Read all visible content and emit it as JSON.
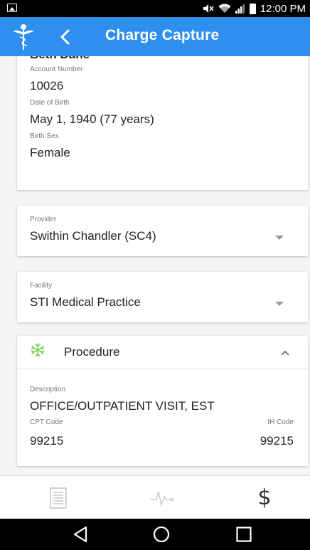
{
  "status_bar": {
    "time": "12:00 PM",
    "icons": [
      "image-notification-icon",
      "mute-icon",
      "wifi-icon",
      "signal-icon",
      "battery-icon"
    ]
  },
  "app_bar": {
    "title": "Charge Capture",
    "logo_icon": "caduceus-icon",
    "back_icon": "chevron-left-icon",
    "color": "#2f8fef"
  },
  "patient": {
    "name": "Beth Dane",
    "account_number_label": "Account Number",
    "account_number": "10026",
    "dob_label": "Date of Birth",
    "dob": "May 1, 1940 (77 years)",
    "birth_sex_label": "Birth Sex",
    "birth_sex": "Female"
  },
  "provider": {
    "label": "Provider",
    "value": "Swithin Chandler (SC4)"
  },
  "facility": {
    "label": "Facility",
    "value": "STI Medical Practice"
  },
  "procedure": {
    "title": "Procedure",
    "icon": "asterisk-icon",
    "icon_color": "#6fd146",
    "description_label": "Description",
    "description": "OFFICE/OUTPATIENT VISIT, EST",
    "cpt_label": "CPT Code",
    "cpt_code": "99215",
    "ih_label": "IH Code",
    "ih_code": "99215"
  },
  "bottom_nav": {
    "items": [
      {
        "icon": "document-list-icon"
      },
      {
        "icon": "pulse-icon"
      },
      {
        "icon": "dollar-icon",
        "glyph": "$"
      }
    ]
  },
  "system_nav": [
    "back-icon",
    "home-icon",
    "recents-icon"
  ]
}
